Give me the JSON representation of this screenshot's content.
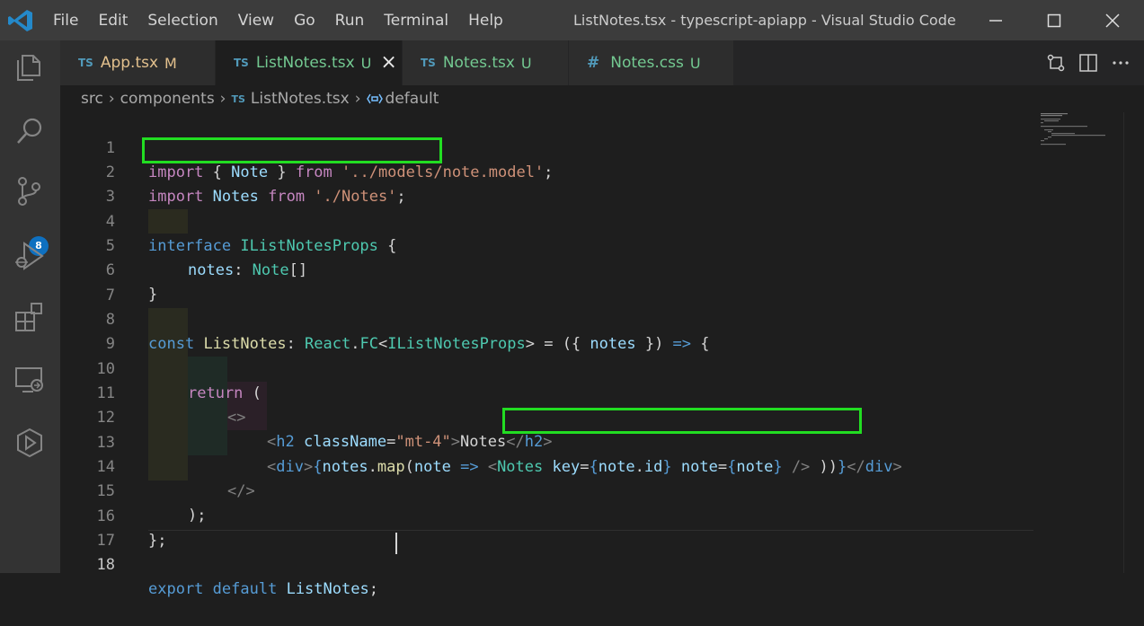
{
  "window": {
    "title": "ListNotes.tsx - typescript-apiapp - Visual Studio Code",
    "menu": [
      "File",
      "Edit",
      "Selection",
      "View",
      "Go",
      "Run",
      "Terminal",
      "Help"
    ]
  },
  "activity_bar": {
    "icons": [
      "explorer-icon",
      "search-icon",
      "source-control-icon",
      "run-debug-icon",
      "extensions-icon",
      "remote-explorer-icon",
      "live-share-icon"
    ],
    "source_control_badge": "8"
  },
  "tabs": [
    {
      "type": "TS",
      "label": "App.tsx",
      "decoration": "M",
      "color": "#e2c08d"
    },
    {
      "type": "TS",
      "label": "ListNotes.tsx",
      "decoration": "U",
      "color": "#73c991",
      "active": true
    },
    {
      "type": "TS",
      "label": "Notes.tsx",
      "decoration": "U",
      "color": "#73c991"
    },
    {
      "type": "#",
      "label": "Notes.css",
      "decoration": "U",
      "color": "#73c991"
    }
  ],
  "breadcrumb": {
    "items": [
      "src",
      "components",
      "ListNotes.tsx",
      "default"
    ],
    "file_type": "TS"
  },
  "editor": {
    "line_numbers": [
      "1",
      "2",
      "3",
      "4",
      "5",
      "6",
      "7",
      "8",
      "9",
      "10",
      "11",
      "12",
      "13",
      "14",
      "15",
      "16",
      "17",
      "18"
    ],
    "current_line": "18",
    "code": {
      "l1": [
        "import",
        " { ",
        "Note",
        " } ",
        "from",
        " '../models/note.model'",
        ";"
      ],
      "l2": [
        "import",
        " ",
        "Notes",
        " ",
        "from",
        " './Notes'",
        ";"
      ],
      "l4": [
        "interface",
        " ",
        "IListNotesProps",
        " {"
      ],
      "l5": [
        "notes",
        ": ",
        "Note",
        "[]"
      ],
      "l6": [
        "}"
      ],
      "l8": [
        "const",
        " ",
        "ListNotes",
        ": ",
        "React",
        ".",
        "FC",
        "<",
        "IListNotesProps",
        "> = ({ ",
        "notes",
        " }) ",
        "=>",
        " {"
      ],
      "l10": [
        "return",
        " ("
      ],
      "l11": [
        "<>"
      ],
      "l12": [
        "<",
        "h2",
        " ",
        "className",
        "=",
        "\"mt-4\"",
        ">",
        "Notes",
        "</",
        "h2",
        ">"
      ],
      "l13": [
        "<",
        "div",
        ">",
        "{",
        "notes",
        ".",
        "map",
        "(",
        "note",
        " ",
        "=>",
        " ",
        "<",
        "Notes",
        " ",
        "key",
        "=",
        "{",
        "note",
        ".",
        "id",
        "}",
        " ",
        "note",
        "=",
        "{",
        "note",
        "}",
        " ",
        "/>",
        " ",
        ")",
        ")",
        "}",
        "</",
        "div",
        ">"
      ],
      "l14": [
        "</>"
      ],
      "l15": [
        ");"
      ],
      "l16": [
        "};"
      ],
      "l18": [
        "export",
        " ",
        "default",
        " ",
        "ListNotes",
        ";"
      ]
    }
  },
  "colors": {
    "highlight_box": "#22dd22",
    "keyword_purple": "#c586c0",
    "storage_blue": "#569cd6",
    "type_teal": "#4ec9b0",
    "variable_lightblue": "#9cdcfe",
    "function_yellow": "#dcdcaa",
    "string_orange": "#ce9178",
    "badge_blue": "#0e70c0"
  }
}
